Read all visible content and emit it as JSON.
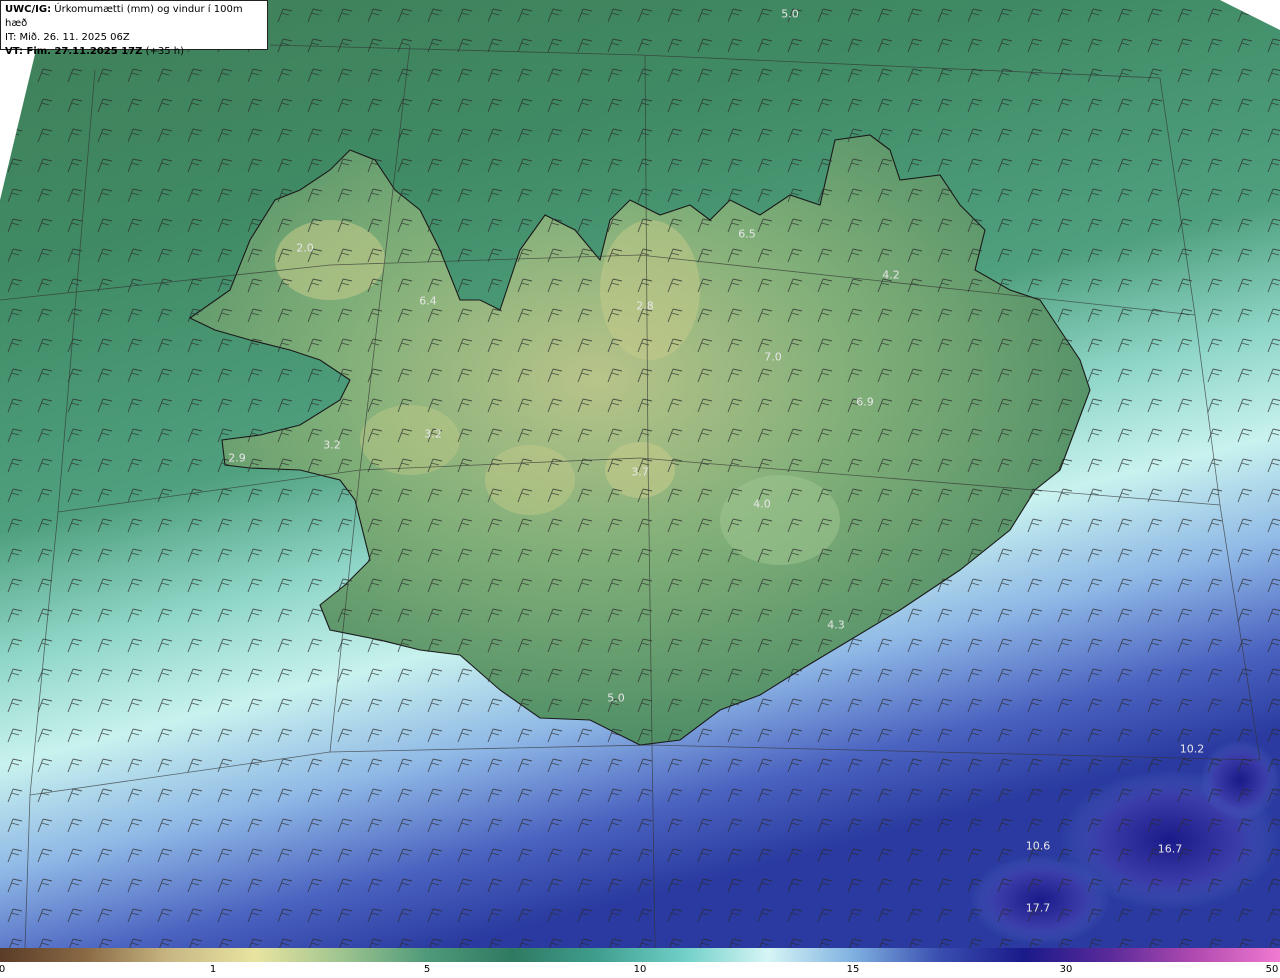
{
  "header": {
    "product": "UWC/IG:",
    "title": "Úrkomumætti (mm) og vindur í 100m hæð",
    "issue_time": "IT: Mið. 26. 11. 2025 06Z",
    "valid_prefix": "VT: Fim. 27.11.2025 17Z",
    "valid_suffix": "(+35 h)"
  },
  "map_labels": [
    {
      "text": "5.0",
      "id": "north-sea"
    },
    {
      "text": "2.0",
      "id": "westfjords-north"
    },
    {
      "text": "6.4",
      "id": "westfjords-east"
    },
    {
      "text": "2.8",
      "id": "north-central"
    },
    {
      "text": "6.5",
      "id": "northeast-coast"
    },
    {
      "text": "4.2",
      "id": "northeast-inland"
    },
    {
      "text": "7.0",
      "id": "north-highlands"
    },
    {
      "text": "6.9",
      "id": "east-highlands"
    },
    {
      "text": "2.9",
      "id": "snaefellsnes-tip"
    },
    {
      "text": "3.2",
      "id": "snaefellsnes"
    },
    {
      "text": "3.2",
      "id": "borgarfjordur"
    },
    {
      "text": "3.7",
      "id": "hofsjokull"
    },
    {
      "text": "4.0",
      "id": "vatnajokull-west"
    },
    {
      "text": "4.3",
      "id": "southeast"
    },
    {
      "text": "5.0",
      "id": "south-coast"
    },
    {
      "text": "10.2",
      "id": "southeast-sea"
    },
    {
      "text": "16.7",
      "id": "far-southeast"
    },
    {
      "text": "10.6",
      "id": "south-sea"
    },
    {
      "text": "17.7",
      "id": "south-bottom"
    }
  ],
  "colorbar": {
    "ticks": [
      "0",
      "1",
      "5",
      "10",
      "15",
      "30",
      "50"
    ],
    "colors": [
      "#5a3c28",
      "#8a6a45",
      "#c9b884",
      "#e8e4a0",
      "#9fc48f",
      "#4f9a7a",
      "#2f7a62",
      "#3f9e8e",
      "#6fcfc8",
      "#d6f5f5",
      "#7fb0e0",
      "#3a4fb0",
      "#1a1a8a",
      "#5a2a9a",
      "#b04ab0",
      "#f07ad0"
    ]
  },
  "colors": {
    "land_low": "#5e9a6e",
    "land_high": "#c8cc8a",
    "sea_north": "#3f8a5e",
    "sea_south_light": "#bff0ee",
    "sea_south_deep": "#3a4fb0",
    "coastline": "#1a1a1a",
    "wind_barb": "#2a2a2a"
  }
}
